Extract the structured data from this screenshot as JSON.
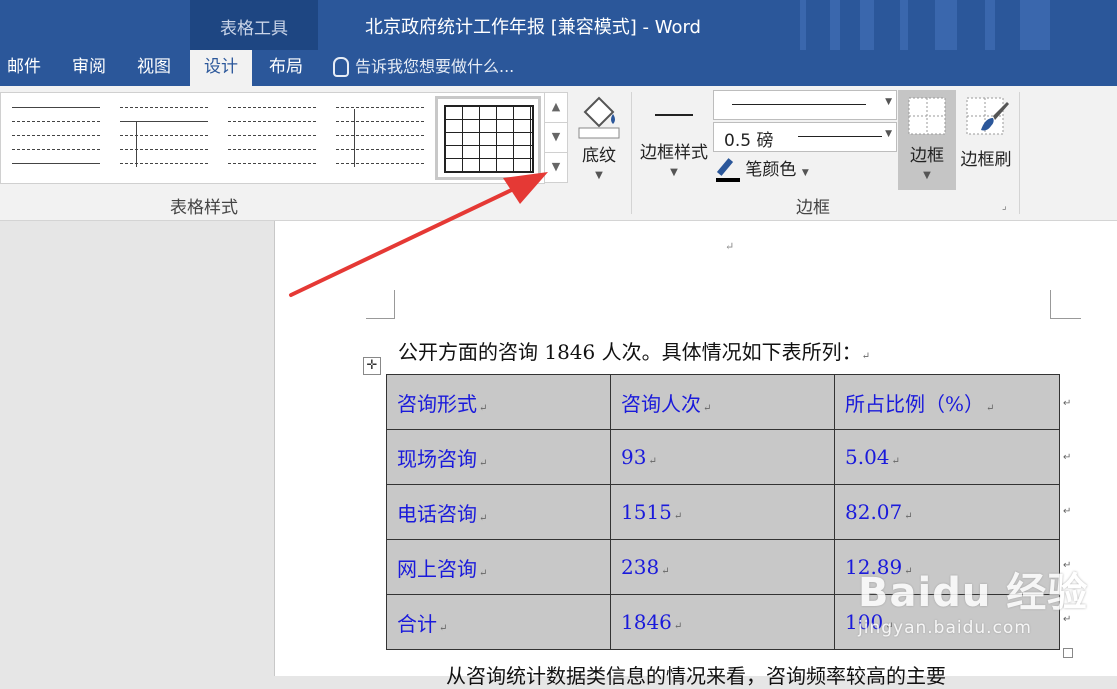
{
  "titlebar": {
    "context_group": "表格工具",
    "doc_title": "北京政府统计工作年报 [兼容模式] - Word"
  },
  "tabs": [
    {
      "label": "邮件"
    },
    {
      "label": "审阅"
    },
    {
      "label": "视图"
    },
    {
      "label": "设计",
      "active": true
    },
    {
      "label": "布局"
    }
  ],
  "tell_me": "告诉我您想要做什么...",
  "ribbon": {
    "table_styles_group": "表格样式",
    "shading_label": "底纹",
    "border_style_label": "边框样式",
    "line_weight": "0.5 磅",
    "pen_color_label": "笔颜色",
    "borders_label": "边框",
    "border_painter_label": "边框刷",
    "borders_group": "边框"
  },
  "document": {
    "intro": "公开方面的咨询 1846 人次。具体情况如下表所列：",
    "table": {
      "headers": [
        "咨询形式",
        "咨询人次",
        "所占比例（%）"
      ],
      "rows": [
        [
          "现场咨询",
          "93",
          "5.04"
        ],
        [
          "电话咨询",
          "1515",
          "82.07"
        ],
        [
          "网上咨询",
          "238",
          "12.89"
        ],
        [
          "合计",
          "1846",
          "100"
        ]
      ]
    },
    "next_paragraph": "从咨询统计数据类信息的情况来看，咨询频率较高的主要"
  },
  "watermark": {
    "logo": "Baidu 经验",
    "url": "jingyan.baidu.com"
  },
  "colors": {
    "titlebar": "#2b579a",
    "context_tab": "#1e4682",
    "table_text": "#1a1adb",
    "table_fill": "#c8c8c8",
    "annotation_arrow": "#e53935"
  }
}
